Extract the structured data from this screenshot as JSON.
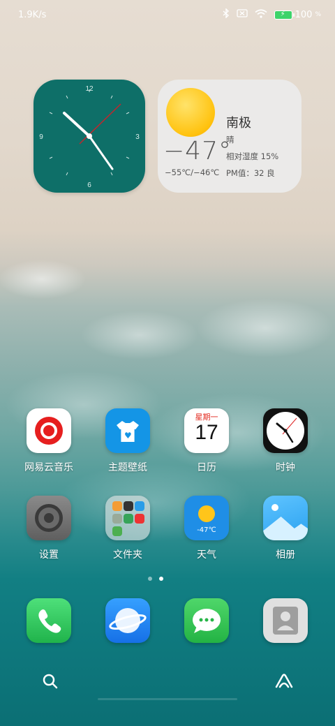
{
  "status_bar": {
    "net_speed": "1.9K/s",
    "battery_percent": "100",
    "battery_unit": "%",
    "icons": [
      "bluetooth-icon",
      "no-sim-icon",
      "wifi-icon",
      "battery-charging-icon"
    ]
  },
  "clock_widget": {
    "numbers": {
      "12": "12",
      "3": "3",
      "6": "6",
      "9": "9"
    }
  },
  "weather_widget": {
    "temperature": "−47°",
    "range": "−55℃/−46℃",
    "city": "南极",
    "condition": "晴",
    "humidity": "相对湿度  15%",
    "pm": "PM值：32  良"
  },
  "apps": [
    {
      "label": "网易云音乐",
      "icon": "netease-music-icon"
    },
    {
      "label": "主题壁纸",
      "icon": "theme-wallpaper-icon"
    },
    {
      "label": "日历",
      "icon": "calendar-icon",
      "weekday": "星期一",
      "day": "17"
    },
    {
      "label": "时钟",
      "icon": "clock-app-icon"
    },
    {
      "label": "设置",
      "icon": "settings-icon"
    },
    {
      "label": "文件夹",
      "icon": "folder-icon"
    },
    {
      "label": "天气",
      "icon": "weather-icon",
      "temp": "-47℃"
    },
    {
      "label": "相册",
      "icon": "gallery-icon"
    }
  ],
  "page_indicator": {
    "pages": 2,
    "current": 2
  },
  "dock": [
    {
      "icon": "phone-icon"
    },
    {
      "icon": "browser-icon"
    },
    {
      "icon": "messages-icon"
    },
    {
      "icon": "contacts-icon"
    }
  ],
  "colors": {
    "clock_widget_bg": "#0e6f68",
    "calendar_red": "#e2271c",
    "music_red": "#e61f1f"
  }
}
